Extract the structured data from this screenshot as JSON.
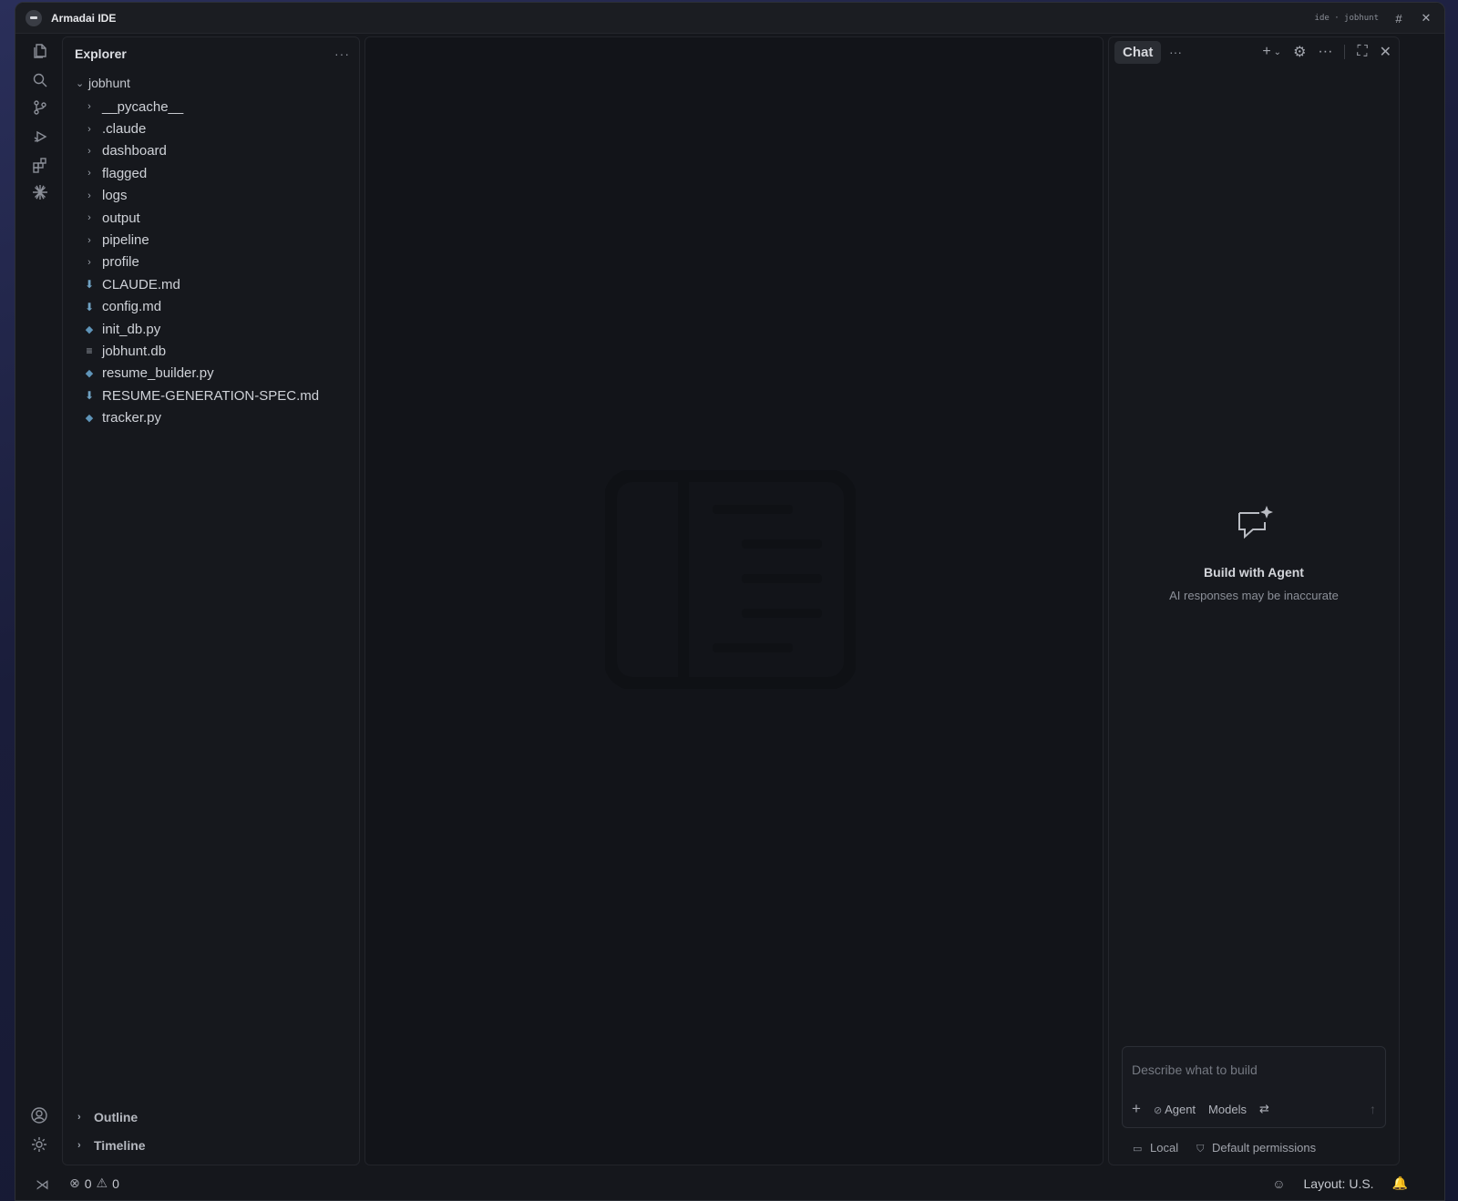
{
  "window": {
    "title": "Armadai IDE",
    "breadcrumb": "ide · jobhunt"
  },
  "explorer": {
    "title": "Explorer",
    "root": "jobhunt",
    "folders": [
      "__pycache__",
      ".claude",
      "dashboard",
      "flagged",
      "logs",
      "output",
      "pipeline",
      "profile"
    ],
    "files": [
      {
        "name": "CLAUDE.md",
        "icon": "markdown-icon"
      },
      {
        "name": "config.md",
        "icon": "markdown-icon"
      },
      {
        "name": "init_db.py",
        "icon": "python-icon"
      },
      {
        "name": "jobhunt.db",
        "icon": "database-icon"
      },
      {
        "name": "resume_builder.py",
        "icon": "python-icon"
      },
      {
        "name": "RESUME-GENERATION-SPEC.md",
        "icon": "markdown-icon"
      },
      {
        "name": "tracker.py",
        "icon": "python-icon"
      }
    ],
    "sections": {
      "outline": "Outline",
      "timeline": "Timeline"
    }
  },
  "chat": {
    "tab": "Chat",
    "empty_title": "Build with Agent",
    "empty_subtitle": "AI responses may be inaccurate",
    "input_placeholder": "Describe what to build",
    "mode": "Agent",
    "models": "Models",
    "location": "Local",
    "permissions": "Default permissions"
  },
  "status": {
    "errors": "0",
    "warnings": "0",
    "layout": "Layout: U.S."
  }
}
